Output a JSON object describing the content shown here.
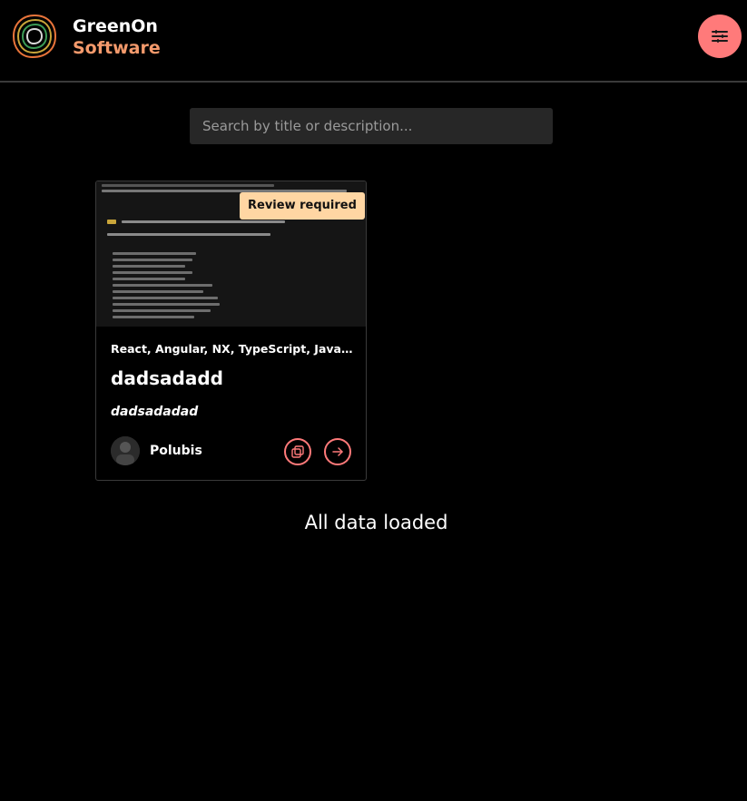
{
  "brand": {
    "name_line1": "GreenOn",
    "name_line2": "Software",
    "colors": {
      "primary_text": "#ffffff",
      "secondary_text": "#f49a6c",
      "accent": "#ff7a7a"
    }
  },
  "header": {
    "menu_icon": "menu-lines-icon"
  },
  "search": {
    "placeholder": "Search by title or description...",
    "value": ""
  },
  "cards": [
    {
      "badge": "Review required",
      "tags": "React, Angular, NX, TypeScript, JavaScript, ...",
      "title": "dadsadadd",
      "description": "dadsadadad",
      "author": "Polubis",
      "actions": {
        "copy_icon": "copy-icon",
        "open_icon": "arrow-right-icon"
      }
    }
  ],
  "status": "All data loaded"
}
